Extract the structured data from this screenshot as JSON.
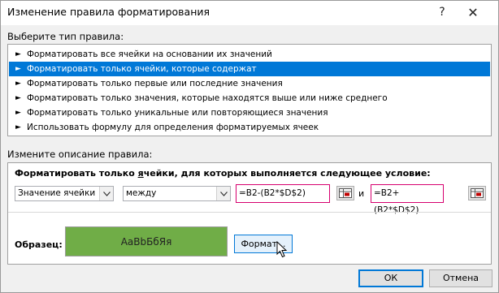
{
  "window": {
    "title": "Изменение правила форматирования",
    "help_symbol": "?",
    "close_symbol": "✕"
  },
  "rule_type": {
    "label": "Выберите тип правила:",
    "items": [
      {
        "label": "Форматировать все ячейки на основании их значений",
        "selected": false
      },
      {
        "label": "Форматировать только ячейки, которые содержат",
        "selected": true
      },
      {
        "label": "Форматировать только первые или последние значения",
        "selected": false
      },
      {
        "label": "Форматировать только значения, которые находятся выше или ниже среднего",
        "selected": false
      },
      {
        "label": "Форматировать только уникальные или повторяющиеся значения",
        "selected": false
      },
      {
        "label": "Использовать формулу для определения форматируемых ячеек",
        "selected": false
      }
    ]
  },
  "description": {
    "label": "Измените описание правила:",
    "condition_prefix": "Форматировать только ",
    "condition_underlined": "я",
    "condition_suffix": "чейки, для которых выполняется следующее условие:",
    "value_combo": "Значение ячейки",
    "operator_combo": "между",
    "ref1": "=B2-(B2*$D$2)",
    "and_label": "и",
    "ref2": "=B2+(B2*$D$2)",
    "preview_label": "Образец:",
    "preview_text": "АаВbБбЯя",
    "preview_color": "#70ad47",
    "format_button": "Формат..."
  },
  "buttons": {
    "ok": "ОК",
    "cancel": "Отмена"
  }
}
